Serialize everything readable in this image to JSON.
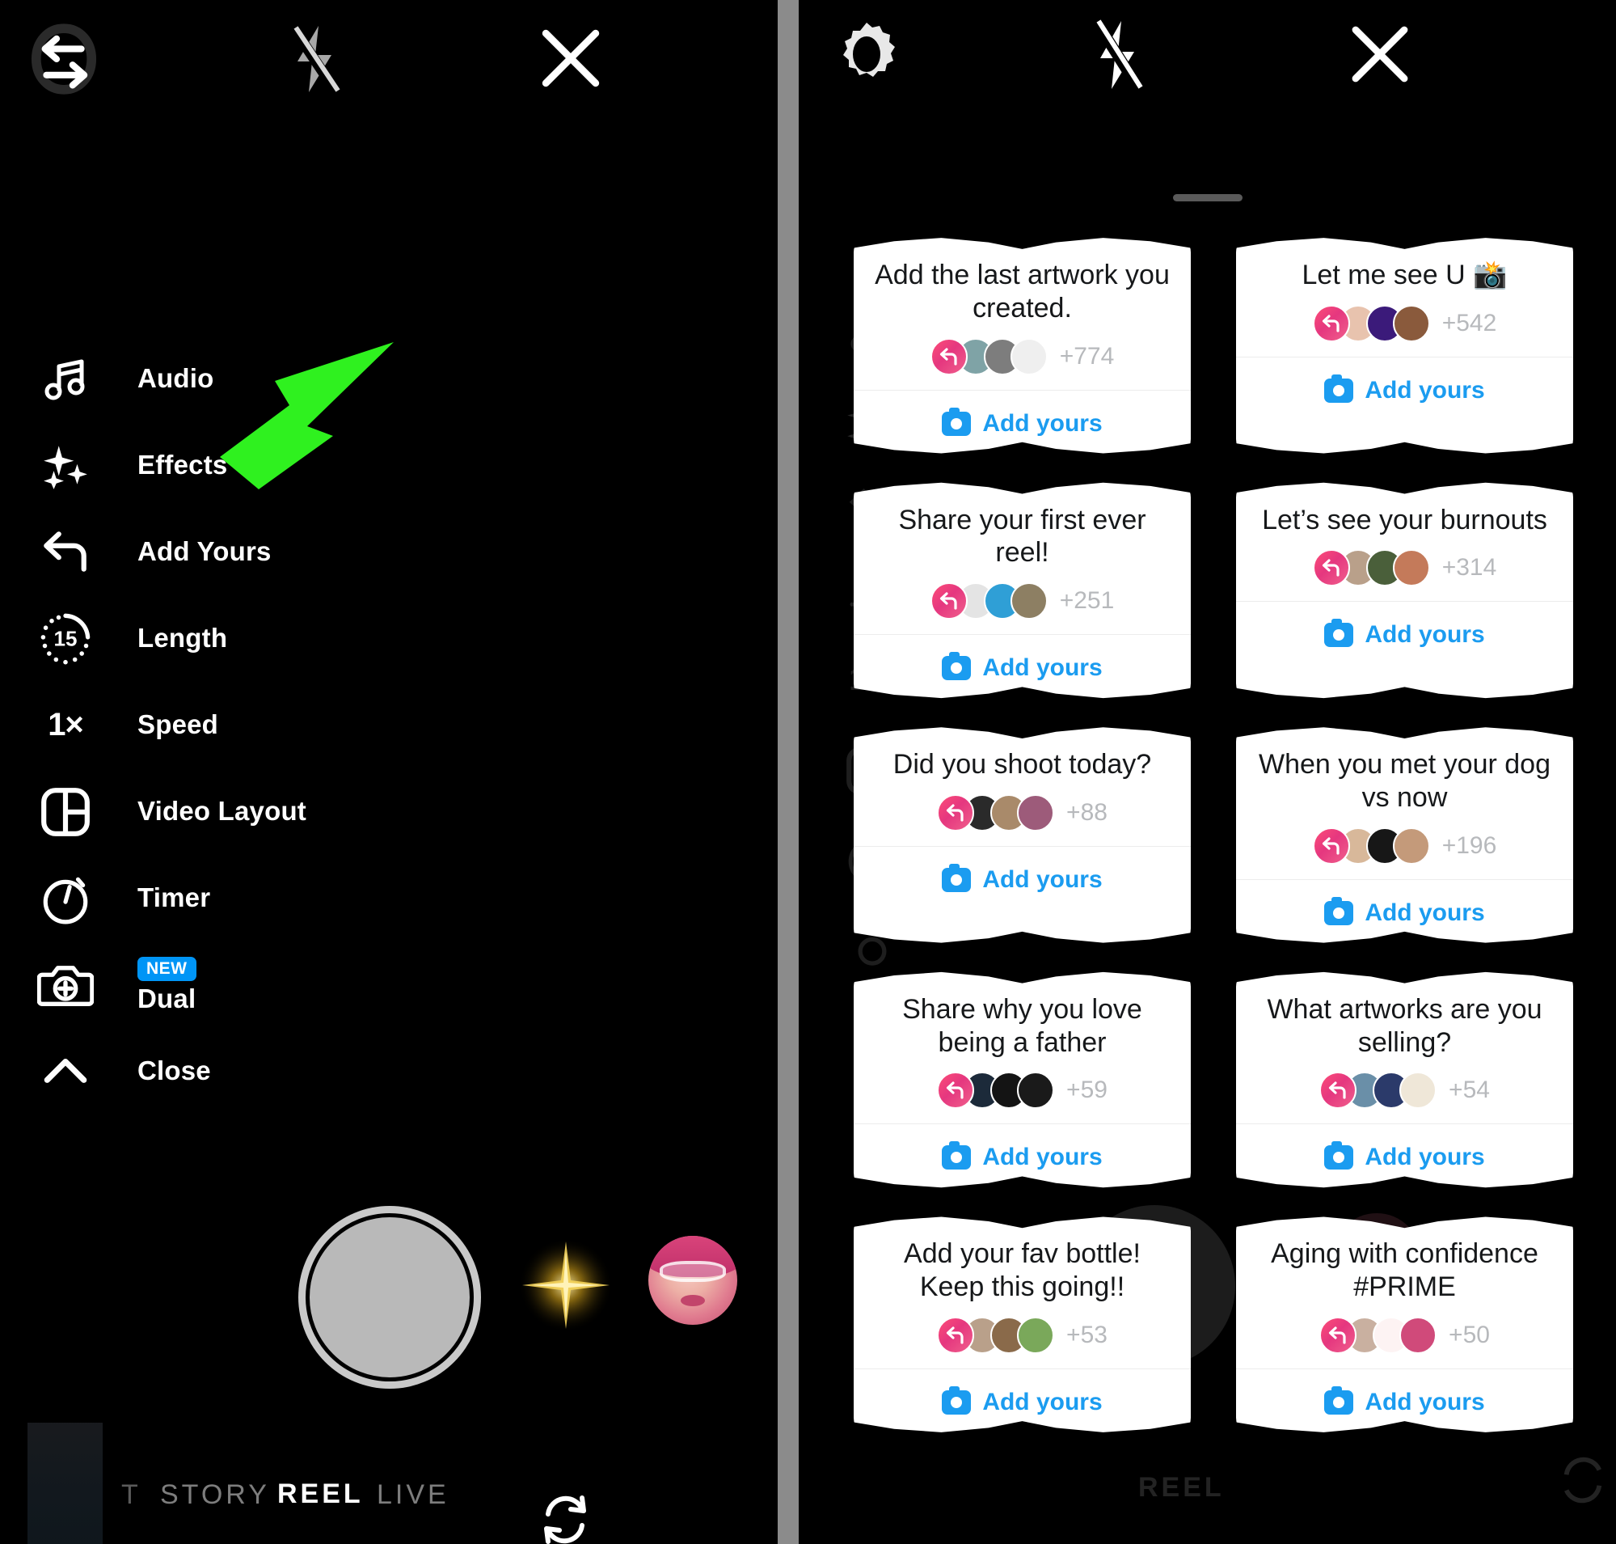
{
  "left_panel": {
    "topbar": {
      "flip_camera_icon": "camera-flip-icon",
      "flash_icon": "flash-off-icon",
      "close_icon": "close-icon"
    },
    "menu_items": [
      {
        "label": "Audio",
        "icon": "music-note-icon"
      },
      {
        "label": "Effects",
        "icon": "sparkles-icon"
      },
      {
        "label": "Add Yours",
        "icon": "reply-arrow-icon"
      },
      {
        "label": "Length",
        "icon": "length-dial-icon",
        "value": "15"
      },
      {
        "label": "Speed",
        "icon": "speed-icon",
        "value": "1×"
      },
      {
        "label": "Video Layout",
        "icon": "grid-layout-icon"
      },
      {
        "label": "Timer",
        "icon": "timer-icon"
      },
      {
        "label": "Dual",
        "icon": "dual-camera-icon",
        "badge": "NEW"
      },
      {
        "label": "Close",
        "icon": "chevron-up-icon"
      }
    ],
    "capture": {
      "shutter": "shutter-button",
      "effects_thumb": "effects-star-icon",
      "gallery_thumb": "gallery-thumbnail"
    },
    "tabs": {
      "cut_off": "T",
      "items": [
        "STORY",
        "REEL",
        "LIVE"
      ],
      "active": "REEL",
      "refresh_icon": "refresh-icon"
    },
    "annotation": {
      "arrow_color": "#2ff11f",
      "points_to": "Add Yours"
    }
  },
  "right_panel": {
    "topbar": {
      "settings_icon": "gear-icon",
      "flash_icon": "flash-off-icon",
      "close_icon": "close-icon"
    },
    "sheet": {
      "handle": "drag-handle",
      "action_label": "Add yours",
      "action_icon": "camera-icon",
      "cards": [
        {
          "title": "Add the last artwork you created.",
          "count": "+774",
          "avatars": [
            "#7fa3a6",
            "#7d7d7d",
            "#efefef"
          ]
        },
        {
          "title": "Let me see U 📸",
          "count": "+542",
          "avatars": [
            "#e8c3ae",
            "#3b1a7a",
            "#8a5a3c"
          ]
        },
        {
          "title": "Share your first ever reel!",
          "count": "+251",
          "avatars": [
            "#e4e4e4",
            "#2f9fd6",
            "#8d7f63"
          ]
        },
        {
          "title": "Let’s see your burnouts",
          "count": "+314",
          "avatars": [
            "#b9a08a",
            "#4a5f3a",
            "#c47a5a"
          ]
        },
        {
          "title": "Did you shoot today?",
          "count": "+88",
          "avatars": [
            "#2a2a2a",
            "#a98a6a",
            "#9d5b7a"
          ]
        },
        {
          "title": "When you met your dog vs now",
          "count": "+196",
          "avatars": [
            "#d8b89a",
            "#171717",
            "#c49a7a"
          ]
        },
        {
          "title": "Share why you love being a father",
          "count": "+59",
          "avatars": [
            "#1c2a3a",
            "#141414",
            "#1a1a1a"
          ]
        },
        {
          "title": "What artworks are you selling?",
          "count": "+54",
          "avatars": [
            "#6a8fa8",
            "#2b3a6a",
            "#efe7d8"
          ]
        },
        {
          "title": "Add your fav bottle! Keep this going!!",
          "count": "+53",
          "avatars": [
            "#b9a08a",
            "#8a6a4a",
            "#7aa85a"
          ]
        },
        {
          "title": "Aging with confidence #PRIME",
          "count": "+50",
          "avatars": [
            "#c9b0a0",
            "#fdf3f3",
            "#d04a7a"
          ]
        }
      ]
    }
  }
}
